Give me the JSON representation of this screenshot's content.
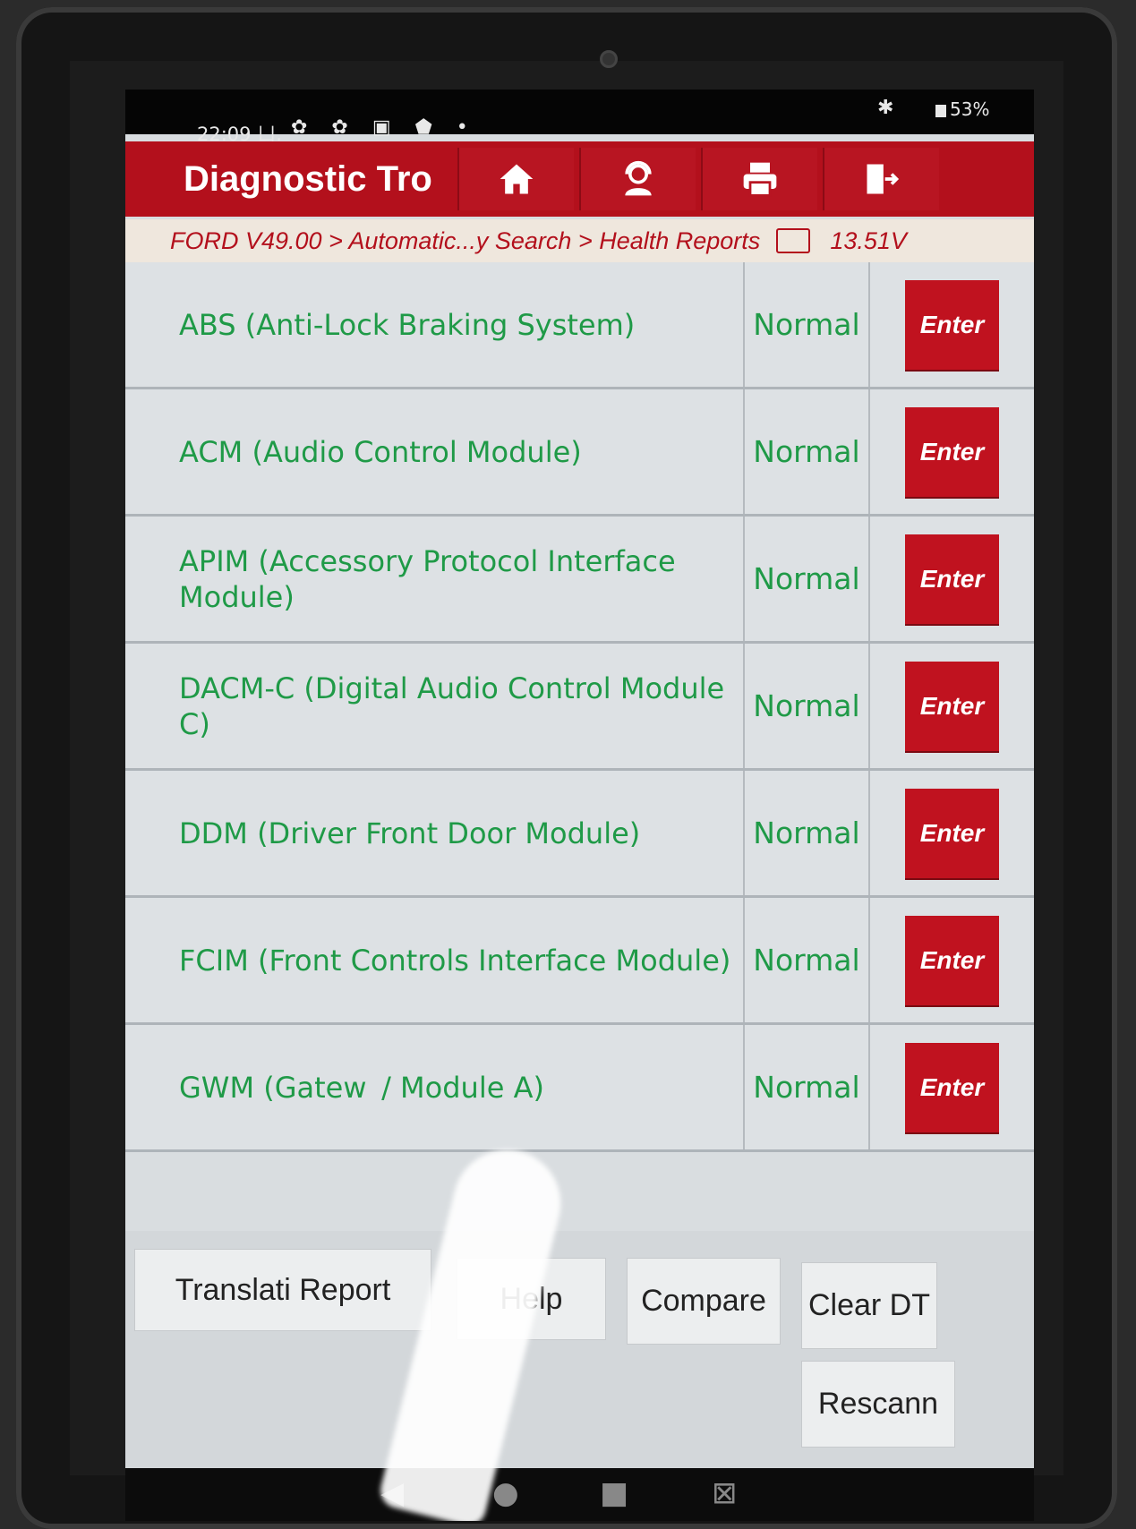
{
  "status_bar": {
    "time": "22:09 ㄩ.",
    "icons": "✿ ✿ ▣ ⬟ •",
    "bluetooth": "✱",
    "battery": "53%"
  },
  "header": {
    "title": "Diagnostic Tro",
    "buttons": [
      {
        "name": "home",
        "icon": "home-icon"
      },
      {
        "name": "support",
        "icon": "person-headset-icon"
      },
      {
        "name": "print",
        "icon": "printer-icon"
      },
      {
        "name": "exit",
        "icon": "exit-icon"
      }
    ]
  },
  "breadcrumb": {
    "path": "FORD V49.00 > Automatic...y Search > Health Reports",
    "voltage": "13.51V"
  },
  "rows": [
    {
      "name": "ABS (Anti-Lock Braking System)",
      "status": "Normal",
      "action": "Enter"
    },
    {
      "name": "ACM (Audio Control Module)",
      "status": "Normal",
      "action": "Enter"
    },
    {
      "name": "APIM (Accessory Protocol Interface Module)",
      "status": "Normal",
      "action": "Enter"
    },
    {
      "name": "DACM-C (Digital Audio Control Module C)",
      "status": "Normal",
      "action": "Enter"
    },
    {
      "name": "DDM (Driver Front Door Module)",
      "status": "Normal",
      "action": "Enter"
    },
    {
      "name": "FCIM (Front Controls Interface Module)",
      "status": "Normal",
      "action": "Enter"
    },
    {
      "name": "GWM (Gatew  / Module A)",
      "status": "Normal",
      "action": "Enter"
    }
  ],
  "footer": {
    "translate_report": "Translati    Report",
    "help": "Help",
    "compare": "Compare",
    "clear_dtc": "Clear DT",
    "rescan": "Rescann"
  },
  "colors": {
    "accent_red": "#b3101c",
    "status_green": "#1f9a47"
  }
}
